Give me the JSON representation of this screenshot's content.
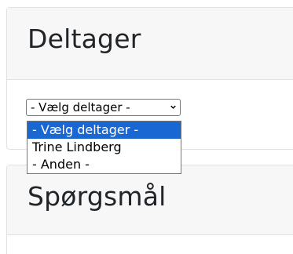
{
  "participant_card": {
    "title": "Deltager"
  },
  "questions_card": {
    "title": "Spørgsmål"
  },
  "participant_select": {
    "selected_value": "- Vælg deltager -",
    "options": [
      "- Vælg deltager -",
      "Trine Lindberg",
      "- Anden -"
    ],
    "highlighted_index": 0
  },
  "icons": {
    "select_arrow": "chevron-down-icon"
  },
  "colors": {
    "highlight": "#1967d2",
    "header_bg": "#f7f7f7",
    "border": "#dee2e6"
  }
}
